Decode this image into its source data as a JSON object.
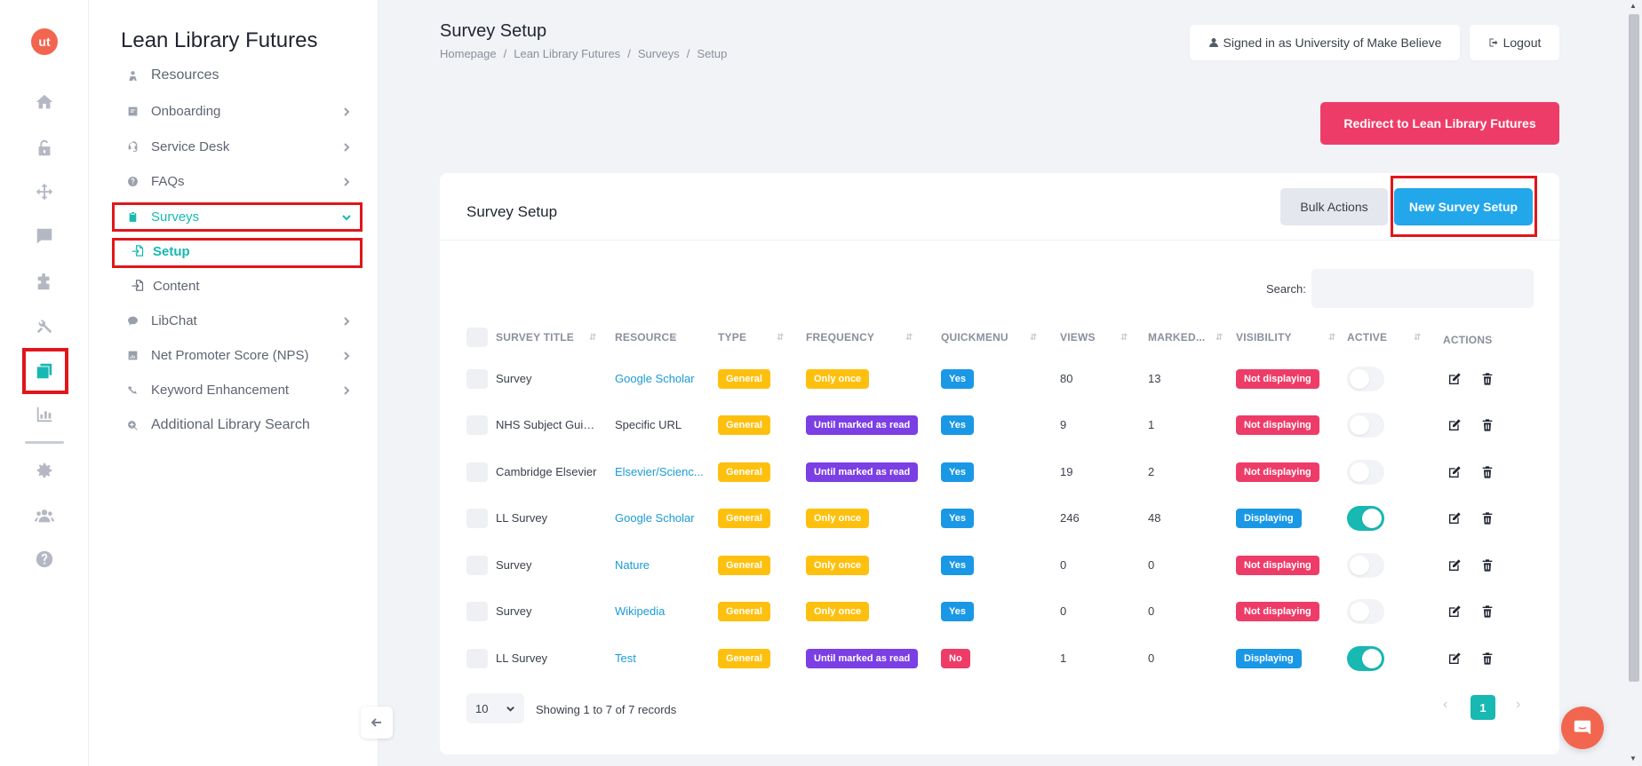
{
  "rail": {
    "logo_text": "ut",
    "icons": [
      "home-icon",
      "unlock-icon",
      "move-icon",
      "comment-icon",
      "puzzle-icon",
      "tools-icon",
      "layers-icon",
      "chart-icon",
      "gear-icon",
      "users-icon",
      "help-icon"
    ],
    "active_icon": "layers-icon"
  },
  "nav": {
    "brand": "Lean Library Futures",
    "items": [
      {
        "label": "Resources",
        "icon": "resources-icon",
        "has_chevron": false
      },
      {
        "label": "Onboarding",
        "icon": "onboarding-icon",
        "has_chevron": true
      },
      {
        "label": "Service Desk",
        "icon": "headset-icon",
        "has_chevron": true
      },
      {
        "label": "FAQs",
        "icon": "question-icon",
        "has_chevron": true
      },
      {
        "label": "Surveys",
        "icon": "clipboard-icon",
        "has_chevron": true,
        "active": true
      },
      {
        "label": "LibChat",
        "icon": "chat-icon",
        "has_chevron": true
      },
      {
        "label": "Net Promoter Score (NPS)",
        "icon": "nps-icon",
        "has_chevron": true
      },
      {
        "label": "Keyword Enhancement",
        "icon": "keyword-icon",
        "has_chevron": true
      },
      {
        "label": "Additional Library Search",
        "icon": "search-plus-icon",
        "has_chevron": false
      }
    ],
    "sub_items": [
      {
        "label": "Setup",
        "icon": "file-import-icon",
        "active": true
      },
      {
        "label": "Content",
        "icon": "file-import-icon",
        "active": false
      }
    ]
  },
  "header": {
    "title": "Survey Setup",
    "breadcrumb": [
      "Homepage",
      "Lean Library Futures",
      "Surveys",
      "Setup"
    ],
    "signed_in": "Signed in as University of Make Believe",
    "logout": "Logout",
    "redirect_button": "Redirect to Lean Library Futures"
  },
  "card": {
    "title": "Survey Setup",
    "bulk_actions": "Bulk Actions",
    "new_button": "New Survey Setup",
    "search_label": "Search:",
    "search_value": "",
    "columns": [
      "Survey Title",
      "Resource",
      "Type",
      "Frequency",
      "Quickmenu",
      "Views",
      "Marked...",
      "Visibility",
      "Active",
      "Actions"
    ],
    "rows": [
      {
        "title": "Survey",
        "resource": "Google Scholar",
        "resource_link": true,
        "type": "General",
        "frequency": "Only once",
        "quickmenu": "Yes",
        "views": "80",
        "marked": "13",
        "visibility": "Not displaying",
        "active": false
      },
      {
        "title": "NHS Subject Guid...",
        "resource": "Specific URL",
        "resource_link": false,
        "type": "General",
        "frequency": "Until marked as read",
        "quickmenu": "Yes",
        "views": "9",
        "marked": "1",
        "visibility": "Not displaying",
        "active": false
      },
      {
        "title": "Cambridge Elsevier",
        "resource": "Elsevier/Scienc...",
        "resource_link": true,
        "type": "General",
        "frequency": "Until marked as read",
        "quickmenu": "Yes",
        "views": "19",
        "marked": "2",
        "visibility": "Not displaying",
        "active": false
      },
      {
        "title": "LL Survey",
        "resource": "Google Scholar",
        "resource_link": true,
        "type": "General",
        "frequency": "Only once",
        "quickmenu": "Yes",
        "views": "246",
        "marked": "48",
        "visibility": "Displaying",
        "active": true
      },
      {
        "title": "Survey",
        "resource": "Nature",
        "resource_link": true,
        "type": "General",
        "frequency": "Only once",
        "quickmenu": "Yes",
        "views": "0",
        "marked": "0",
        "visibility": "Not displaying",
        "active": false
      },
      {
        "title": "Survey",
        "resource": "Wikipedia",
        "resource_link": true,
        "type": "General",
        "frequency": "Only once",
        "quickmenu": "Yes",
        "views": "0",
        "marked": "0",
        "visibility": "Not displaying",
        "active": false
      },
      {
        "title": "LL Survey",
        "resource": "Test",
        "resource_link": true,
        "type": "General",
        "frequency": "Until marked as read",
        "quickmenu": "No",
        "views": "1",
        "marked": "0",
        "visibility": "Displaying",
        "active": true
      }
    ],
    "page_size": "10",
    "records_text": "Showing 1 to 7 of 7 records",
    "current_page": "1"
  },
  "colors": {
    "accent": "#18b8b3",
    "primary_blue": "#22a7ea",
    "danger": "#ee3c68",
    "warning": "#fec00f",
    "purple": "#7b3fe4",
    "highlight": "#e0161a"
  }
}
